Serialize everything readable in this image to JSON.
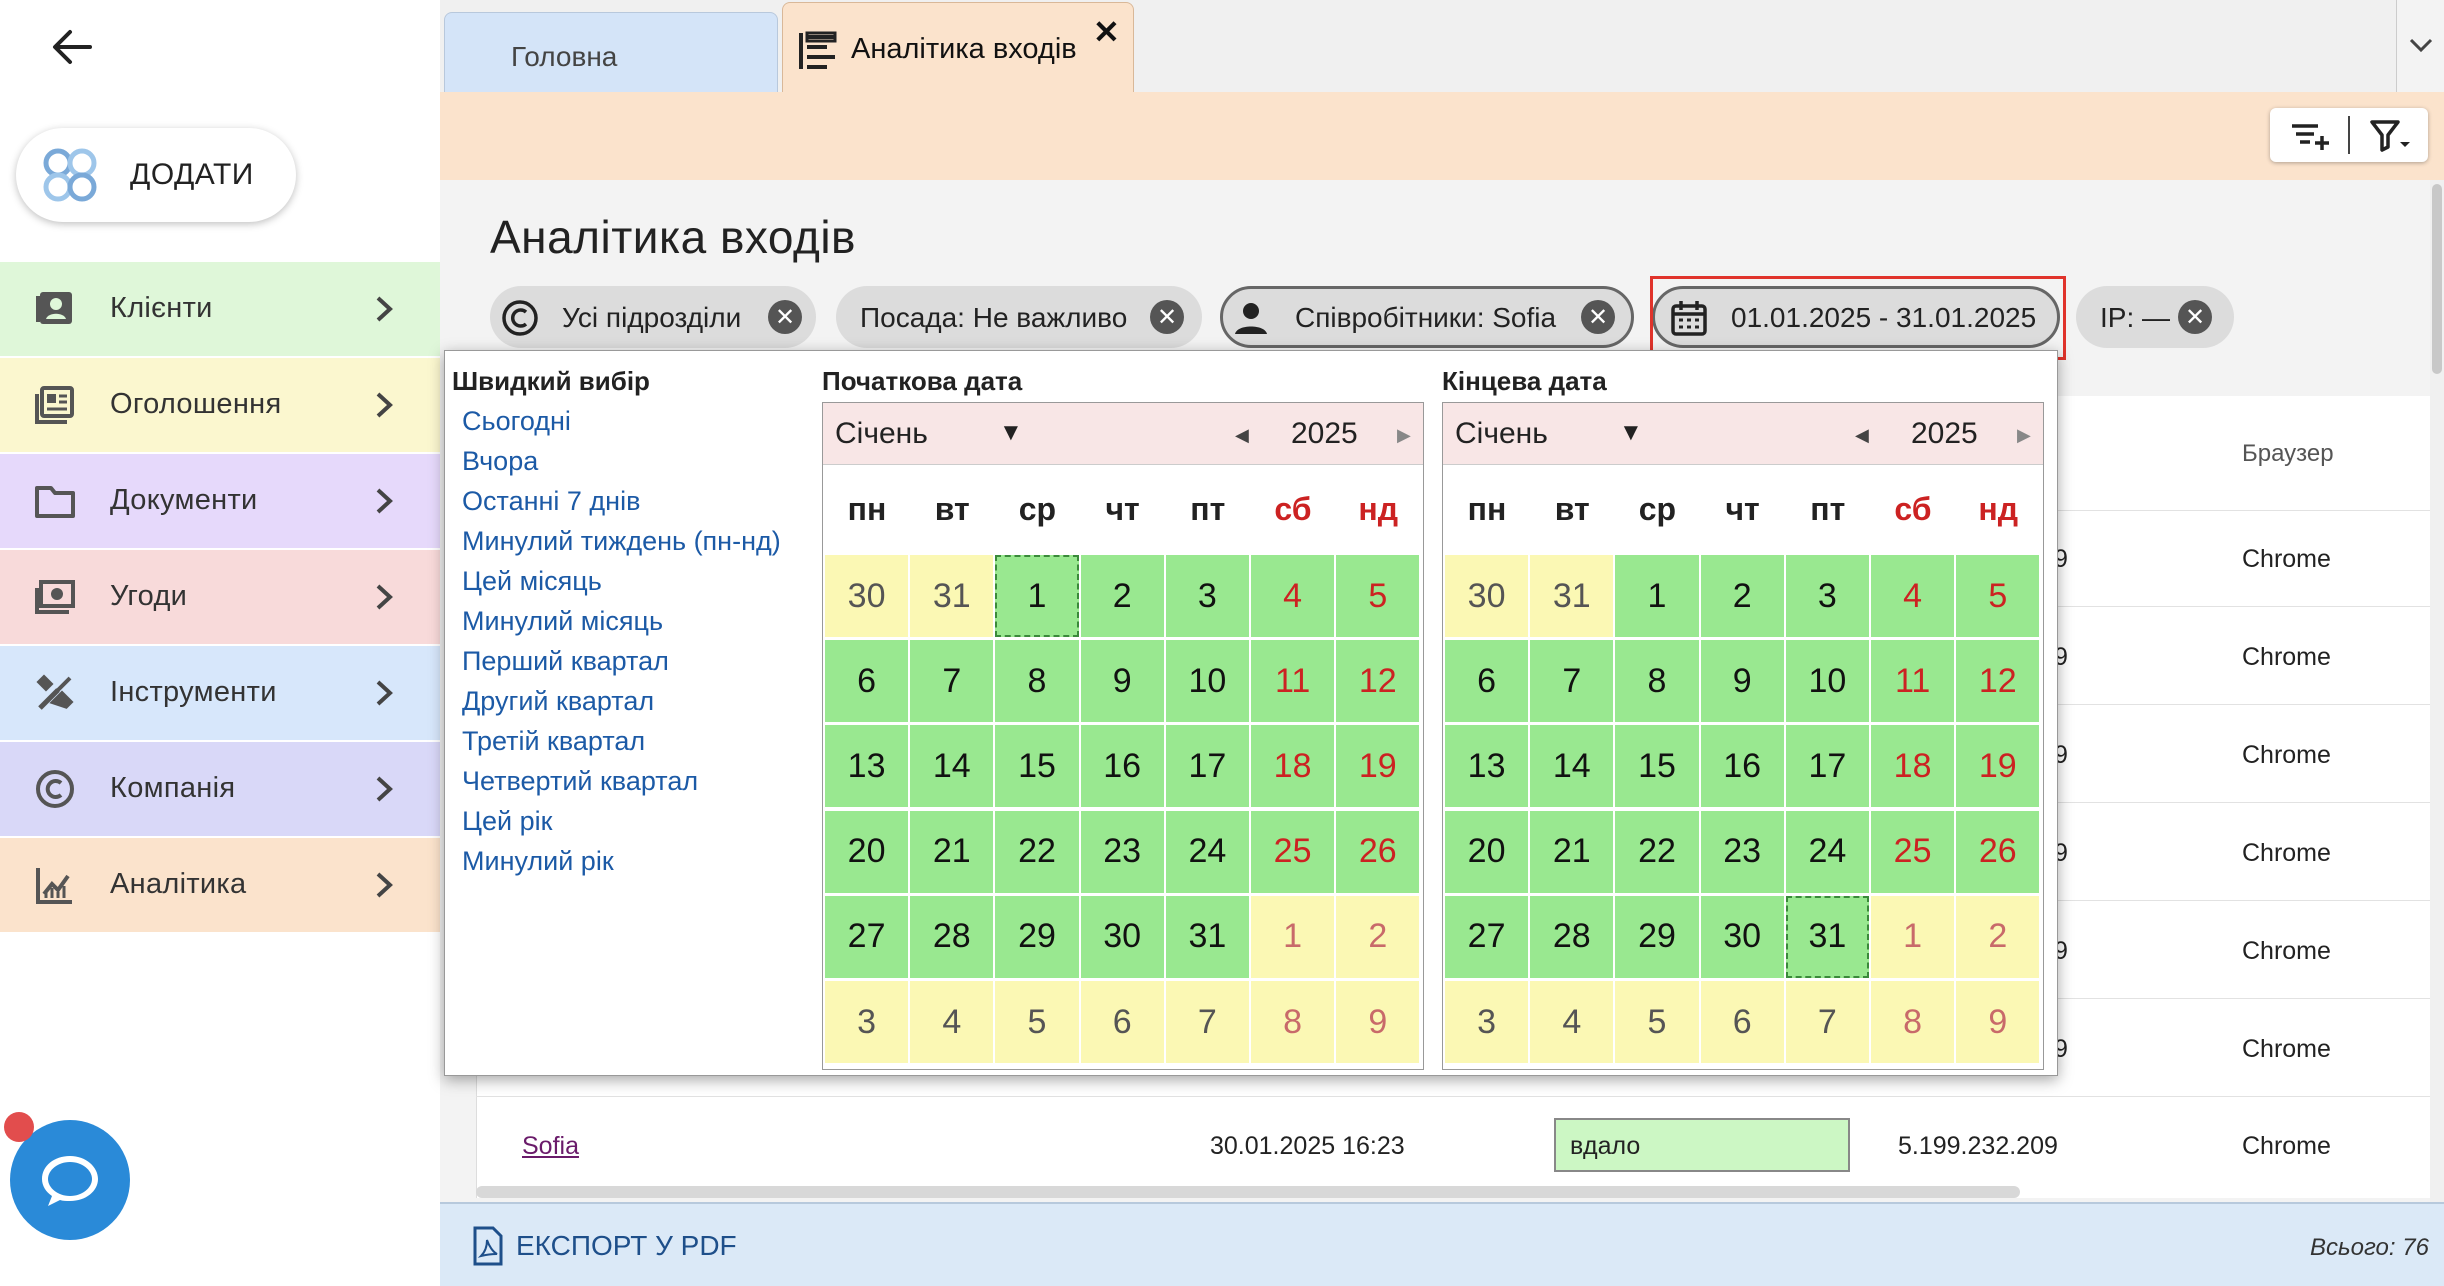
{
  "sidebar": {
    "add_label": "ДОДАТИ",
    "items": [
      {
        "label": "Клієнти",
        "icon": "contacts-icon",
        "color": "#dff7d9"
      },
      {
        "label": "Оголошення",
        "icon": "listings-icon",
        "color": "#fbf7cf"
      },
      {
        "label": "Документи",
        "icon": "folder-icon",
        "color": "#e6d9fb"
      },
      {
        "label": "Угоди",
        "icon": "money-icon",
        "color": "#f8dada"
      },
      {
        "label": "Інструменти",
        "icon": "tools-icon",
        "color": "#d7e7fb"
      },
      {
        "label": "Компанія",
        "icon": "copyright-icon",
        "color": "#d9d8f8"
      },
      {
        "label": "Аналітика",
        "icon": "chart-icon",
        "color": "#fbe3cc"
      }
    ]
  },
  "tabs": [
    {
      "label": "Головна"
    },
    {
      "label": "Аналітика входів"
    }
  ],
  "page": {
    "title": "Аналітика входів",
    "filters": {
      "departments": "Усі підрозділи",
      "position": "Посада: Не важливо",
      "employees": "Співробітники: Sofia",
      "dates": "01.01.2025 - 31.01.2025",
      "ip": "IP: —"
    }
  },
  "table": {
    "browser_header": "Браузер",
    "browser_values": [
      "Chrome",
      "Chrome",
      "Chrome",
      "Chrome",
      "Chrome",
      "Chrome"
    ],
    "clipped_values": [
      "9",
      "9",
      "9",
      "9",
      "9",
      "9"
    ],
    "last_row": {
      "user": "Sofia",
      "datetime": "30.01.2025 16:23",
      "status": "вдало",
      "ip": "5.199.232.209",
      "browser": "Chrome"
    }
  },
  "footer": {
    "export_label": "ЕКСПОРТ У PDF",
    "total": "Всього: 76"
  },
  "picker": {
    "quick_title": "Швидкий вибір",
    "quick_items": [
      "Сьогодні",
      "Вчора",
      "Останні 7 днів",
      "Минулий тиждень (пн-нд)",
      "Цей місяць",
      "Минулий місяць",
      "Перший квартал",
      "Другий квартал",
      "Третій квартал",
      "Четвертий квартал",
      "Цей рік",
      "Минулий рік"
    ],
    "start_title": "Початкова дата",
    "end_title": "Кінцева дата",
    "month": "Січень",
    "year": "2025",
    "weekdays": [
      "пн",
      "вт",
      "ср",
      "чт",
      "пт",
      "сб",
      "нд"
    ],
    "days": [
      "30",
      "31",
      "1",
      "2",
      "3",
      "4",
      "5",
      "6",
      "7",
      "8",
      "9",
      "10",
      "11",
      "12",
      "13",
      "14",
      "15",
      "16",
      "17",
      "18",
      "19",
      "20",
      "21",
      "22",
      "23",
      "24",
      "25",
      "26",
      "27",
      "28",
      "29",
      "30",
      "31",
      "1",
      "2",
      "3",
      "4",
      "5",
      "6",
      "7",
      "8",
      "9"
    ],
    "start_selected": "1",
    "end_selected": "31"
  },
  "colors": {
    "in_month": "#99e890",
    "out_month": "#fbf8b4",
    "weekend": "#cc2222",
    "highlight": "#e0332b"
  }
}
